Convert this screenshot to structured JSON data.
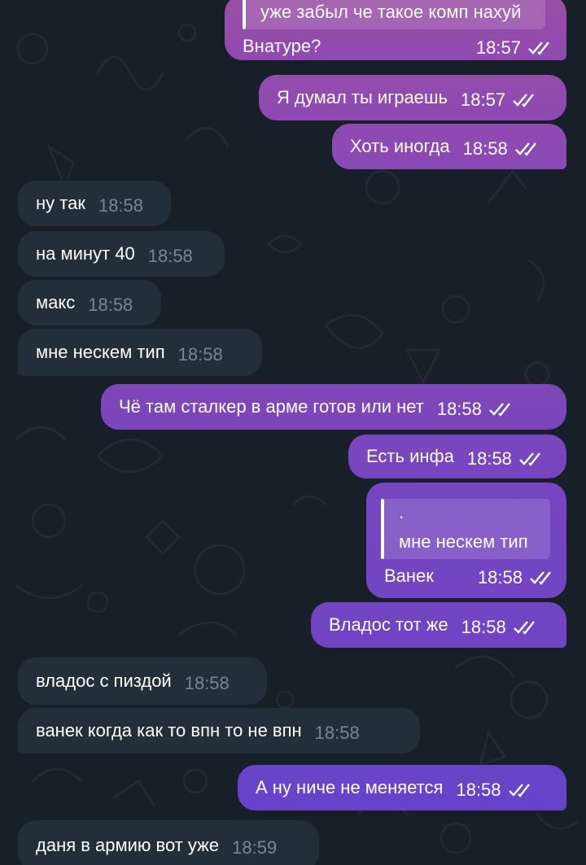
{
  "colors": {
    "background": "#172029",
    "incoming_bubble": "#222e39",
    "outgoing_gradient_top": "#9a4ea3",
    "outgoing_gradient_bottom": "#5945c8",
    "incoming_time": "#7a8591"
  },
  "messages": [
    {
      "direction": "out",
      "quote": {
        "text": "уже забыл че такое комп нахуй"
      },
      "text": "Внатуре?",
      "time": "18:57",
      "status": "read-double-check"
    },
    {
      "direction": "out",
      "text": "Я думал ты играешь",
      "time": "18:57",
      "status": "read-double-check"
    },
    {
      "direction": "out",
      "text": "Хоть иногда",
      "time": "18:58",
      "status": "read-double-check"
    },
    {
      "direction": "in",
      "text": "ну так",
      "time": "18:58"
    },
    {
      "direction": "in",
      "text": "на минут 40",
      "time": "18:58"
    },
    {
      "direction": "in",
      "text": "макс",
      "time": "18:58"
    },
    {
      "direction": "in",
      "text": "мне нескем тип",
      "time": "18:58"
    },
    {
      "direction": "out",
      "text": "Чё там сталкер в арме готов или нет",
      "time": "18:58",
      "status": "read-double-check"
    },
    {
      "direction": "out",
      "text": "Есть инфа",
      "time": "18:58",
      "status": "read-double-check"
    },
    {
      "direction": "out",
      "quote": {
        "sender": ".",
        "text": "мне нескем тип"
      },
      "text": "Ванек",
      "time": "18:58",
      "status": "read-double-check"
    },
    {
      "direction": "out",
      "text": "Владос тот же",
      "time": "18:58",
      "status": "read-double-check"
    },
    {
      "direction": "in",
      "text": "владос с пиздой",
      "time": "18:58"
    },
    {
      "direction": "in",
      "text": "ванек когда как то впн то не впн",
      "time": "18:58"
    },
    {
      "direction": "out",
      "text": "А ну ниче не меняется",
      "time": "18:58",
      "status": "read-double-check"
    },
    {
      "direction": "in",
      "text": "даня в армию вот уже",
      "time": "18:59"
    }
  ]
}
